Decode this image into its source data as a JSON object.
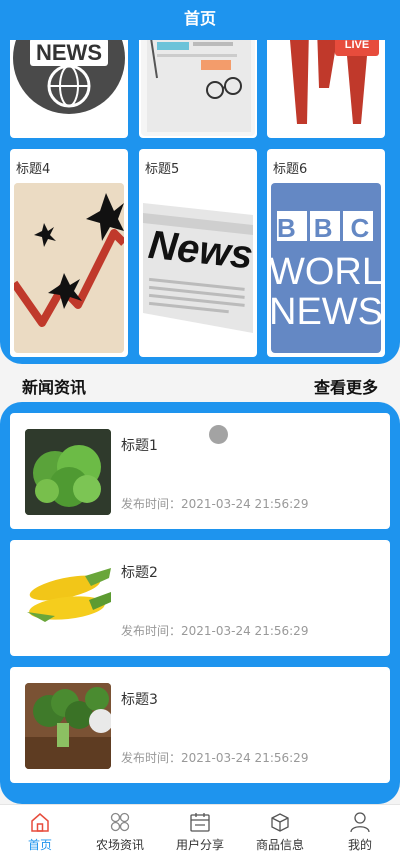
{
  "header": {
    "title": "首页"
  },
  "grid": {
    "row1": [
      {
        "label": "",
        "image": "news-globe"
      },
      {
        "label": "",
        "image": "newspaper-glasses"
      },
      {
        "label": "",
        "image": "live-microphones"
      }
    ],
    "row2": [
      {
        "label": "标题4",
        "image": "market-crash-chart"
      },
      {
        "label": "标题5",
        "image": "news-paper"
      },
      {
        "label": "标题6",
        "image": "bbc-world-news",
        "logo_text": [
          "BBC",
          "WORLD",
          "NEWS"
        ]
      }
    ]
  },
  "section": {
    "title": "新闻资讯",
    "more": "查看更多"
  },
  "news": [
    {
      "title": "标题1",
      "time": "发布时间：2021-03-24 21:56:29",
      "image": "lettuce"
    },
    {
      "title": "标题2",
      "time": "发布时间：2021-03-24 21:56:29",
      "image": "corn"
    },
    {
      "title": "标题3",
      "time": "发布时间：2021-03-24 21:56:29",
      "image": "broccoli"
    }
  ],
  "tabbar": [
    {
      "label": "首页",
      "icon": "home-icon",
      "active": true
    },
    {
      "label": "农场资讯",
      "icon": "grid-icon",
      "active": false
    },
    {
      "label": "用户分享",
      "icon": "calendar-icon",
      "active": false
    },
    {
      "label": "商品信息",
      "icon": "box-icon",
      "active": false
    },
    {
      "label": "我的",
      "icon": "user-icon",
      "active": false
    }
  ],
  "colors": {
    "primary": "#1e94ee",
    "active_tab": "#e74c3c"
  }
}
